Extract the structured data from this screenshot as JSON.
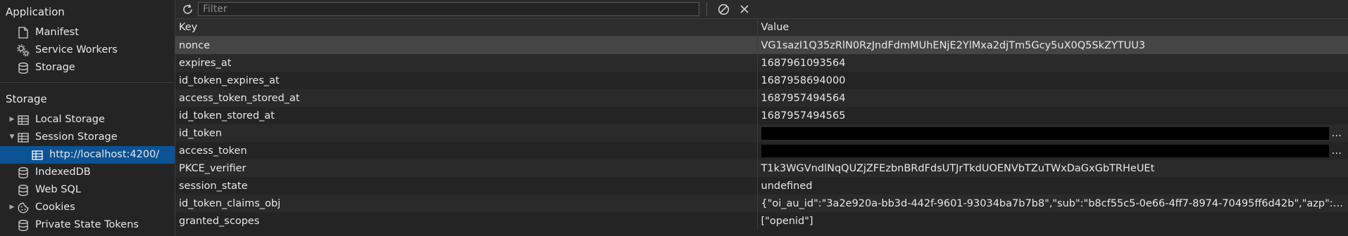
{
  "sidebar": {
    "application": {
      "title": "Application",
      "items": [
        {
          "label": "Manifest",
          "icon": "document-icon"
        },
        {
          "label": "Service Workers",
          "icon": "gears-icon"
        },
        {
          "label": "Storage",
          "icon": "database-icon"
        }
      ]
    },
    "storage": {
      "title": "Storage",
      "items": [
        {
          "label": "Local Storage",
          "icon": "table-icon",
          "expanded": false
        },
        {
          "label": "Session Storage",
          "icon": "table-icon",
          "expanded": true
        },
        {
          "label": "http://localhost:4200/",
          "icon": "table-icon",
          "selected": true
        },
        {
          "label": "IndexedDB",
          "icon": "database-icon"
        },
        {
          "label": "Web SQL",
          "icon": "database-icon"
        },
        {
          "label": "Cookies",
          "icon": "cookie-icon",
          "expanded": false
        },
        {
          "label": "Private State Tokens",
          "icon": "database-icon"
        }
      ]
    }
  },
  "toolbar": {
    "filter_placeholder": "Filter"
  },
  "table": {
    "headers": {
      "key": "Key",
      "value": "Value"
    },
    "rows": [
      {
        "key": "nonce",
        "value": "VG1sazI1Q35zRlN0RzJndFdmMUhENjE2YlMxa2djTm5Gcy5uX0Q5SkZYTUU3",
        "selected": true
      },
      {
        "key": "expires_at",
        "value": "1687961093564"
      },
      {
        "key": "id_token_expires_at",
        "value": "1687958694000"
      },
      {
        "key": "access_token_stored_at",
        "value": "1687957494564"
      },
      {
        "key": "id_token_stored_at",
        "value": "1687957494565"
      },
      {
        "key": "id_token",
        "value": "…",
        "redacted": true
      },
      {
        "key": "access_token",
        "value": "…",
        "redacted": true
      },
      {
        "key": "PKCE_verifier",
        "value": "T1k3WGVndlNqQUZjZFEzbnBRdFdsUTJrTkdUOENVbTZuTWxDaGxGbTRHeUEt"
      },
      {
        "key": "session_state",
        "value": "undefined"
      },
      {
        "key": "id_token_claims_obj",
        "value": "{\"oi_au_id\":\"3a2e920a-bb3d-442f-9601-93034ba7b7b8\",\"sub\":\"b8cf55c5-0e66-4ff7-8974-70495ff6d42b\",\"azp\":\"OASys\",\"n..."
      },
      {
        "key": "granted_scopes",
        "value": "[\"openid\"]"
      }
    ]
  }
}
